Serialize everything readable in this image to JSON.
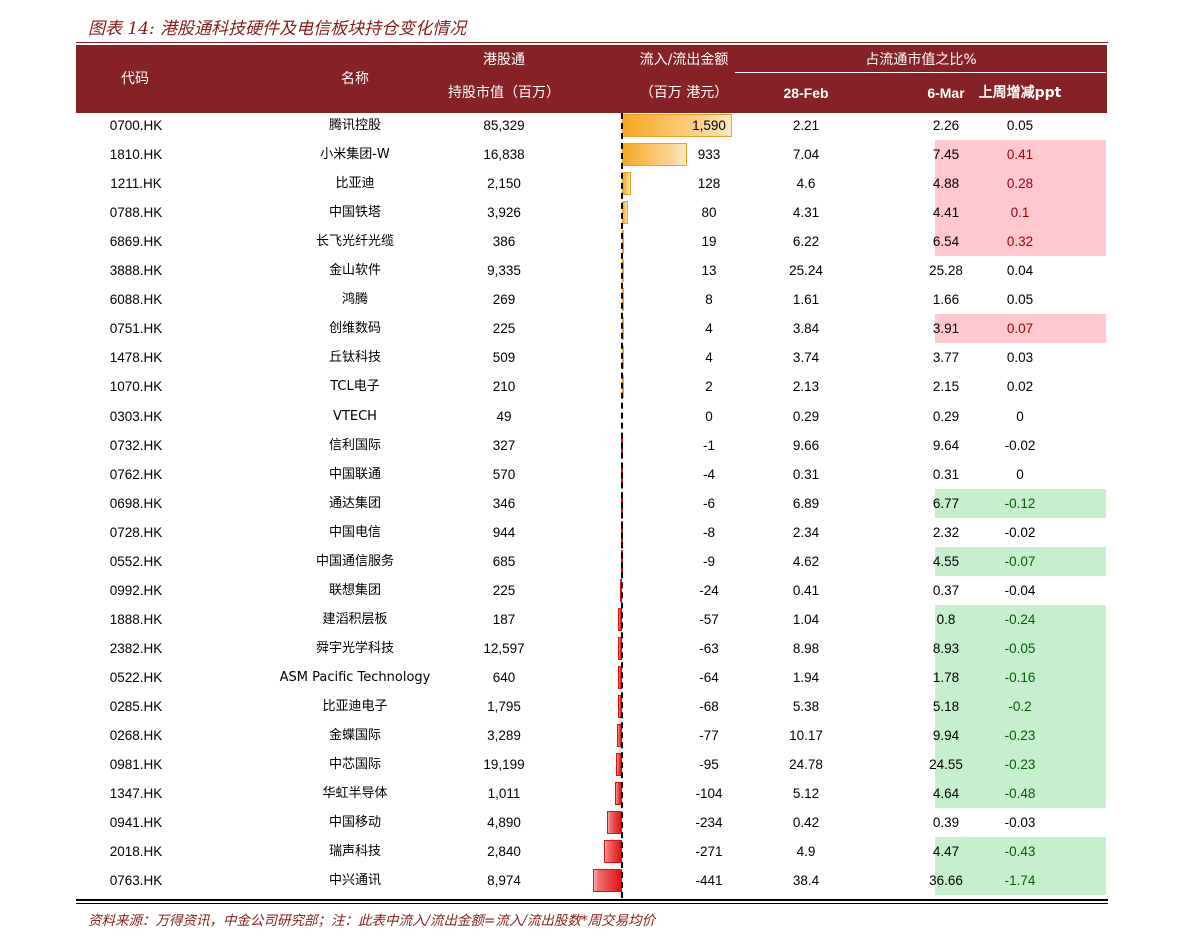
{
  "title": "图表 14: 港股通科技硬件及电信板块持仓变化情况",
  "header": {
    "code": "代码",
    "name": "名称",
    "cap_line1": "港股通",
    "cap_line2": "持股市值（百万）",
    "flow_line1": "流入/流出金额",
    "flow_line2": "（百万 港元）",
    "pct_group": "占流通市值之比%",
    "feb": "28-Feb",
    "mar": "6-Mar",
    "chg": "上周增减ppt"
  },
  "colors": {
    "header_bg": "#862226",
    "positive_highlight": "#ffc7ce",
    "negative_highlight": "#c6efce",
    "inflow_bar": "#f7a823",
    "outflow_bar": "#e01010"
  },
  "rows": [
    {
      "code": "0700.HK",
      "name": "腾讯控股",
      "cap": "85,329",
      "flow": "1,590",
      "feb": "2.21",
      "mar": "2.26",
      "chg": "0.05"
    },
    {
      "code": "1810.HK",
      "name": "小米集团-W",
      "cap": "16,838",
      "flow": "933",
      "feb": "7.04",
      "mar": "7.45",
      "chg": "0.41"
    },
    {
      "code": "1211.HK",
      "name": "比亚迪",
      "cap": "2,150",
      "flow": "128",
      "feb": "4.6",
      "mar": "4.88",
      "chg": "0.28"
    },
    {
      "code": "0788.HK",
      "name": "中国铁塔",
      "cap": "3,926",
      "flow": "80",
      "feb": "4.31",
      "mar": "4.41",
      "chg": "0.1"
    },
    {
      "code": "6869.HK",
      "name": "长飞光纤光缆",
      "cap": "386",
      "flow": "19",
      "feb": "6.22",
      "mar": "6.54",
      "chg": "0.32"
    },
    {
      "code": "3888.HK",
      "name": "金山软件",
      "cap": "9,335",
      "flow": "13",
      "feb": "25.24",
      "mar": "25.28",
      "chg": "0.04"
    },
    {
      "code": "6088.HK",
      "name": "鸿腾",
      "cap": "269",
      "flow": "8",
      "feb": "1.61",
      "mar": "1.66",
      "chg": "0.05"
    },
    {
      "code": "0751.HK",
      "name": "创维数码",
      "cap": "225",
      "flow": "4",
      "feb": "3.84",
      "mar": "3.91",
      "chg": "0.07"
    },
    {
      "code": "1478.HK",
      "name": "丘钛科技",
      "cap": "509",
      "flow": "4",
      "feb": "3.74",
      "mar": "3.77",
      "chg": "0.03"
    },
    {
      "code": "1070.HK",
      "name": "TCL电子",
      "cap": "210",
      "flow": "2",
      "feb": "2.13",
      "mar": "2.15",
      "chg": "0.02"
    },
    {
      "code": "0303.HK",
      "name": "VTECH",
      "cap": "49",
      "flow": "0",
      "feb": "0.29",
      "mar": "0.29",
      "chg": "0"
    },
    {
      "code": "0732.HK",
      "name": "信利国际",
      "cap": "327",
      "flow": "-1",
      "feb": "9.66",
      "mar": "9.64",
      "chg": "-0.02"
    },
    {
      "code": "0762.HK",
      "name": "中国联通",
      "cap": "570",
      "flow": "-4",
      "feb": "0.31",
      "mar": "0.31",
      "chg": "0"
    },
    {
      "code": "0698.HK",
      "name": "通达集团",
      "cap": "346",
      "flow": "-6",
      "feb": "6.89",
      "mar": "6.77",
      "chg": "-0.12"
    },
    {
      "code": "0728.HK",
      "name": "中国电信",
      "cap": "944",
      "flow": "-8",
      "feb": "2.34",
      "mar": "2.32",
      "chg": "-0.02"
    },
    {
      "code": "0552.HK",
      "name": "中国通信服务",
      "cap": "685",
      "flow": "-9",
      "feb": "4.62",
      "mar": "4.55",
      "chg": "-0.07"
    },
    {
      "code": "0992.HK",
      "name": "联想集团",
      "cap": "225",
      "flow": "-24",
      "feb": "0.41",
      "mar": "0.37",
      "chg": "-0.04"
    },
    {
      "code": "1888.HK",
      "name": "建滔积层板",
      "cap": "187",
      "flow": "-57",
      "feb": "1.04",
      "mar": "0.8",
      "chg": "-0.24"
    },
    {
      "code": "2382.HK",
      "name": "舜宇光学科技",
      "cap": "12,597",
      "flow": "-63",
      "feb": "8.98",
      "mar": "8.93",
      "chg": "-0.05"
    },
    {
      "code": "0522.HK",
      "name": "ASM Pacific Technology",
      "cap": "640",
      "flow": "-64",
      "feb": "1.94",
      "mar": "1.78",
      "chg": "-0.16"
    },
    {
      "code": "0285.HK",
      "name": "比亚迪电子",
      "cap": "1,795",
      "flow": "-68",
      "feb": "5.38",
      "mar": "5.18",
      "chg": "-0.2"
    },
    {
      "code": "0268.HK",
      "name": "金蝶国际",
      "cap": "3,289",
      "flow": "-77",
      "feb": "10.17",
      "mar": "9.94",
      "chg": "-0.23"
    },
    {
      "code": "0981.HK",
      "name": "中芯国际",
      "cap": "19,199",
      "flow": "-95",
      "feb": "24.78",
      "mar": "24.55",
      "chg": "-0.23"
    },
    {
      "code": "1347.HK",
      "name": "华虹半导体",
      "cap": "1,011",
      "flow": "-104",
      "feb": "5.12",
      "mar": "4.64",
      "chg": "-0.48"
    },
    {
      "code": "0941.HK",
      "name": "中国移动",
      "cap": "4,890",
      "flow": "-234",
      "feb": "0.42",
      "mar": "0.39",
      "chg": "-0.03"
    },
    {
      "code": "2018.HK",
      "name": "瑞声科技",
      "cap": "2,840",
      "flow": "-271",
      "feb": "4.9",
      "mar": "4.47",
      "chg": "-0.43"
    },
    {
      "code": "0763.HK",
      "name": "中兴通讯",
      "cap": "8,974",
      "flow": "-441",
      "feb": "38.4",
      "mar": "36.66",
      "chg": "-1.74"
    }
  ],
  "highlights": {
    "positive_rows": [
      1,
      2,
      3,
      4,
      7
    ],
    "negative_rows": [
      13,
      15,
      17,
      18,
      19,
      20,
      21,
      22,
      23,
      25,
      26
    ]
  },
  "source": "资料来源：万得资讯，中金公司研究部；注：此表中流入/流出金额=流入/流出股数*周交易均价"
}
